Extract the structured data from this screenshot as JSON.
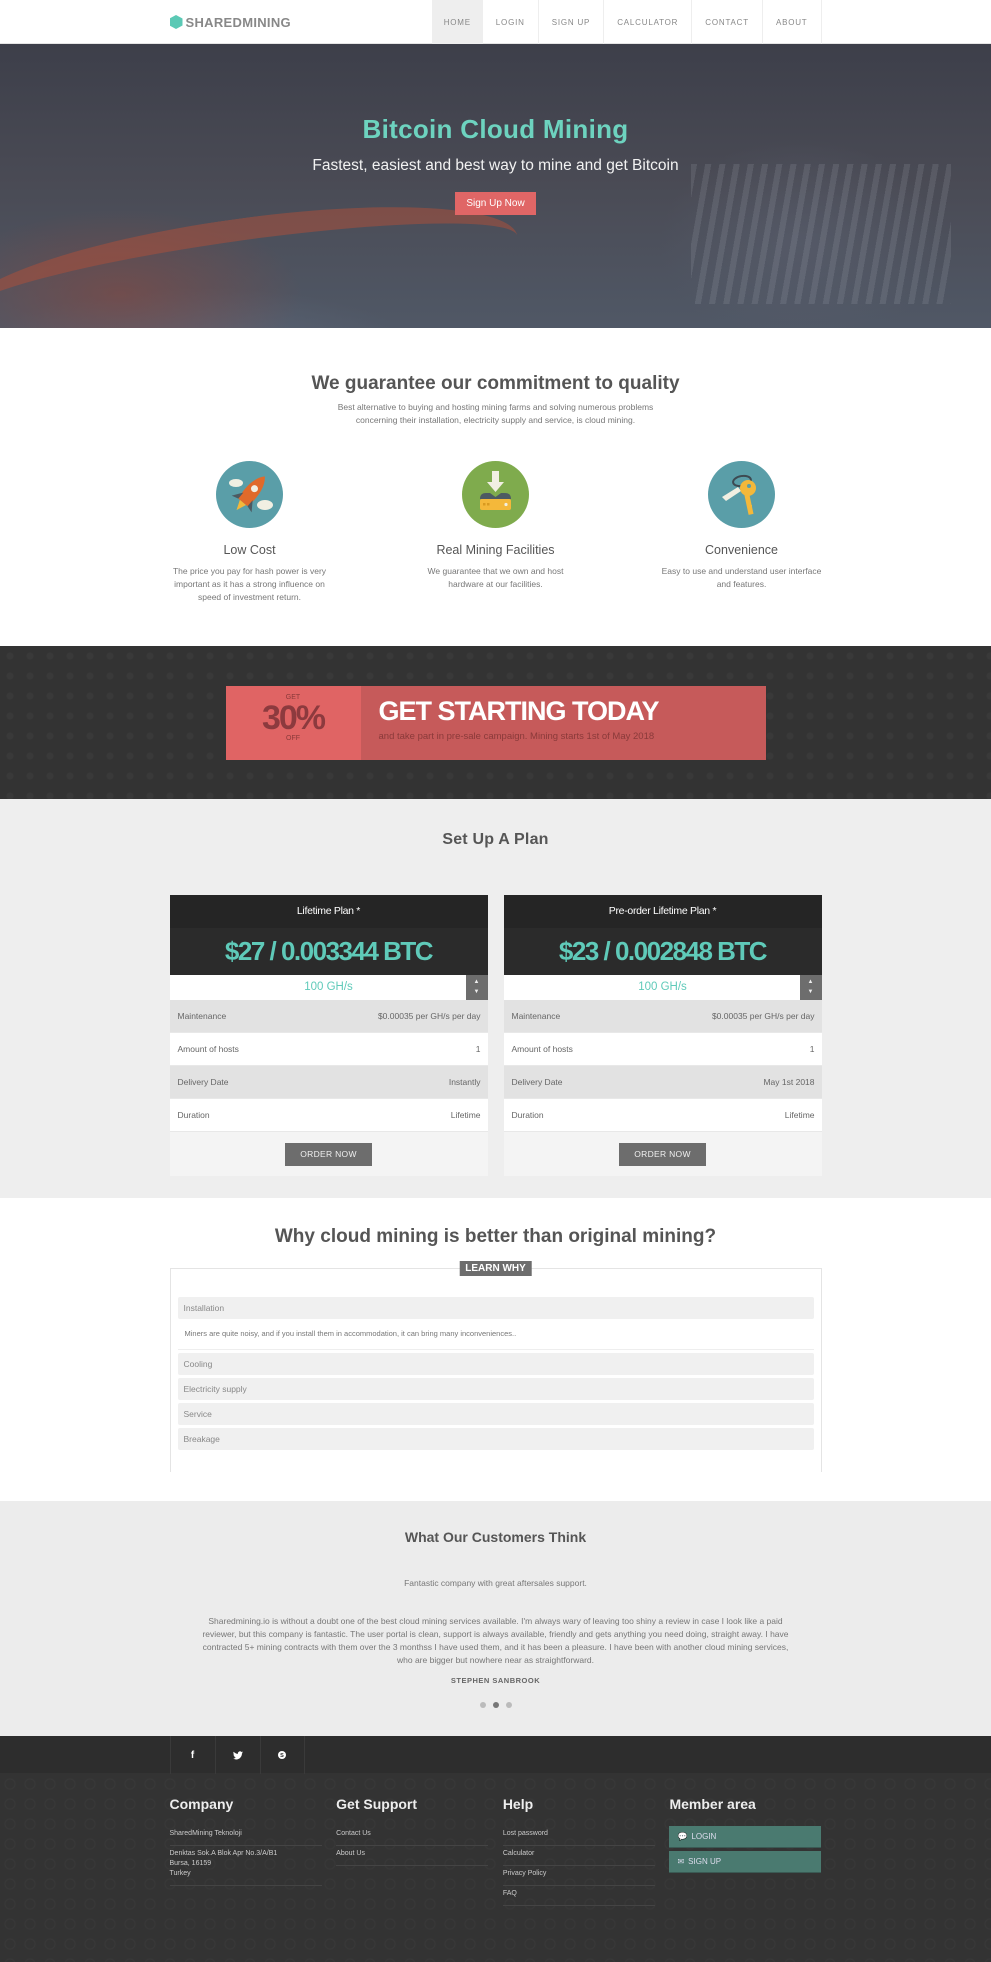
{
  "nav": {
    "logo": "SHAREDMINING",
    "items": [
      {
        "label": "HOME",
        "active": true
      },
      {
        "label": "LOGIN"
      },
      {
        "label": "SIGN UP"
      },
      {
        "label": "CALCULATOR"
      },
      {
        "label": "CONTACT"
      },
      {
        "label": "ABOUT"
      }
    ]
  },
  "hero": {
    "title": "Bitcoin Cloud Mining",
    "subtitle": "Fastest, easiest and best way to mine and get Bitcoin",
    "cta": "Sign Up Now"
  },
  "quality": {
    "title": "We guarantee our commitment to quality",
    "lead_1": "Best alternative to buying and hosting mining farms and solving numerous problems",
    "lead_2": "concerning their installation, electricity supply and service, is cloud mining.",
    "features": [
      {
        "icon": "rocket-icon",
        "title": "Low Cost",
        "text": "The price you pay for hash power is very important as it has a strong influence on speed of investment return."
      },
      {
        "icon": "server-download-icon",
        "title": "Real Mining Facilities",
        "text": "We guarantee that we own and host hardware at our facilities."
      },
      {
        "icon": "keys-icon",
        "title": "Convenience",
        "text": "Easy to use and understand user interface and features."
      }
    ]
  },
  "promo": {
    "get": "GET",
    "percent": "30%",
    "off": "OFF",
    "title": "GET STARTING TODAY",
    "text": "and take part in pre-sale campaign. Mining starts 1st of May 2018"
  },
  "plans": {
    "title": "Set Up A Plan",
    "items": [
      {
        "name": "Lifetime Plan *",
        "price": "$27 / 0.003344 BTC",
        "hashrate": "100 GH/s",
        "rows": [
          {
            "label": "Maintenance",
            "value": "$0.00035 per GH/s per day"
          },
          {
            "label": "Amount of hosts",
            "value": "1"
          },
          {
            "label": "Delivery Date",
            "value": "Instantly"
          },
          {
            "label": "Duration",
            "value": "Lifetime"
          }
        ],
        "button": "ORDER NOW"
      },
      {
        "name": "Pre-order Lifetime Plan *",
        "price": "$23 / 0.002848 BTC",
        "hashrate": "100 GH/s",
        "rows": [
          {
            "label": "Maintenance",
            "value": "$0.00035 per GH/s per day"
          },
          {
            "label": "Amount of hosts",
            "value": "1"
          },
          {
            "label": "Delivery Date",
            "value": "May 1st 2018"
          },
          {
            "label": "Duration",
            "value": "Lifetime"
          }
        ],
        "button": "ORDER NOW"
      }
    ]
  },
  "why": {
    "title": "Why cloud mining is better than original mining?",
    "badge": "LEARN WHY",
    "accordion": [
      {
        "title": "Installation",
        "body": "Miners are quite noisy, and if you install them in accommodation, it can bring many inconveniences..",
        "open": true
      },
      {
        "title": "Cooling"
      },
      {
        "title": "Electricity supply"
      },
      {
        "title": "Service"
      },
      {
        "title": "Breakage"
      }
    ]
  },
  "testimonials": {
    "title": "What Our Customers Think",
    "tagline": "Fantastic company with great aftersales support.",
    "quote": "Sharedmining.io is without a doubt one of the best cloud mining services available. I'm always wary of leaving too shiny a review in case I look like a paid reviewer, but this company is fantastic. The user portal is clean, support is always available, friendly and gets anything you need doing, straight away. I have contracted 5+ mining contracts with them over the 3 monthss I have used them, and it has been a pleasure. I have been with another cloud mining services, who are bigger but nowhere near as straightforward.",
    "author": "STEPHEN SANBROOK",
    "active_dot": 2,
    "dot_count": 3
  },
  "social": {
    "facebook": "f",
    "twitter": "🐦",
    "skype": "S"
  },
  "footer": {
    "company": {
      "title": "Company",
      "name": "SharedMining Teknoloji",
      "address_1": "Denktas Sok.A Blok Apr No.3/A/B1",
      "address_2": "Bursa, 16159",
      "address_3": "Turkey"
    },
    "support": {
      "title": "Get Support",
      "links": [
        "Contact Us",
        "About Us"
      ]
    },
    "help": {
      "title": "Help",
      "links": [
        "Lost password",
        "Calculator",
        "Privacy Policy",
        "FAQ"
      ]
    },
    "member": {
      "title": "Member area",
      "login": "LOGIN",
      "signup": "SIGN UP"
    }
  },
  "colors": {
    "accent_teal": "#5fcab9",
    "accent_red": "#e06666",
    "dark": "#333333",
    "member_button": "#4a7a70"
  }
}
